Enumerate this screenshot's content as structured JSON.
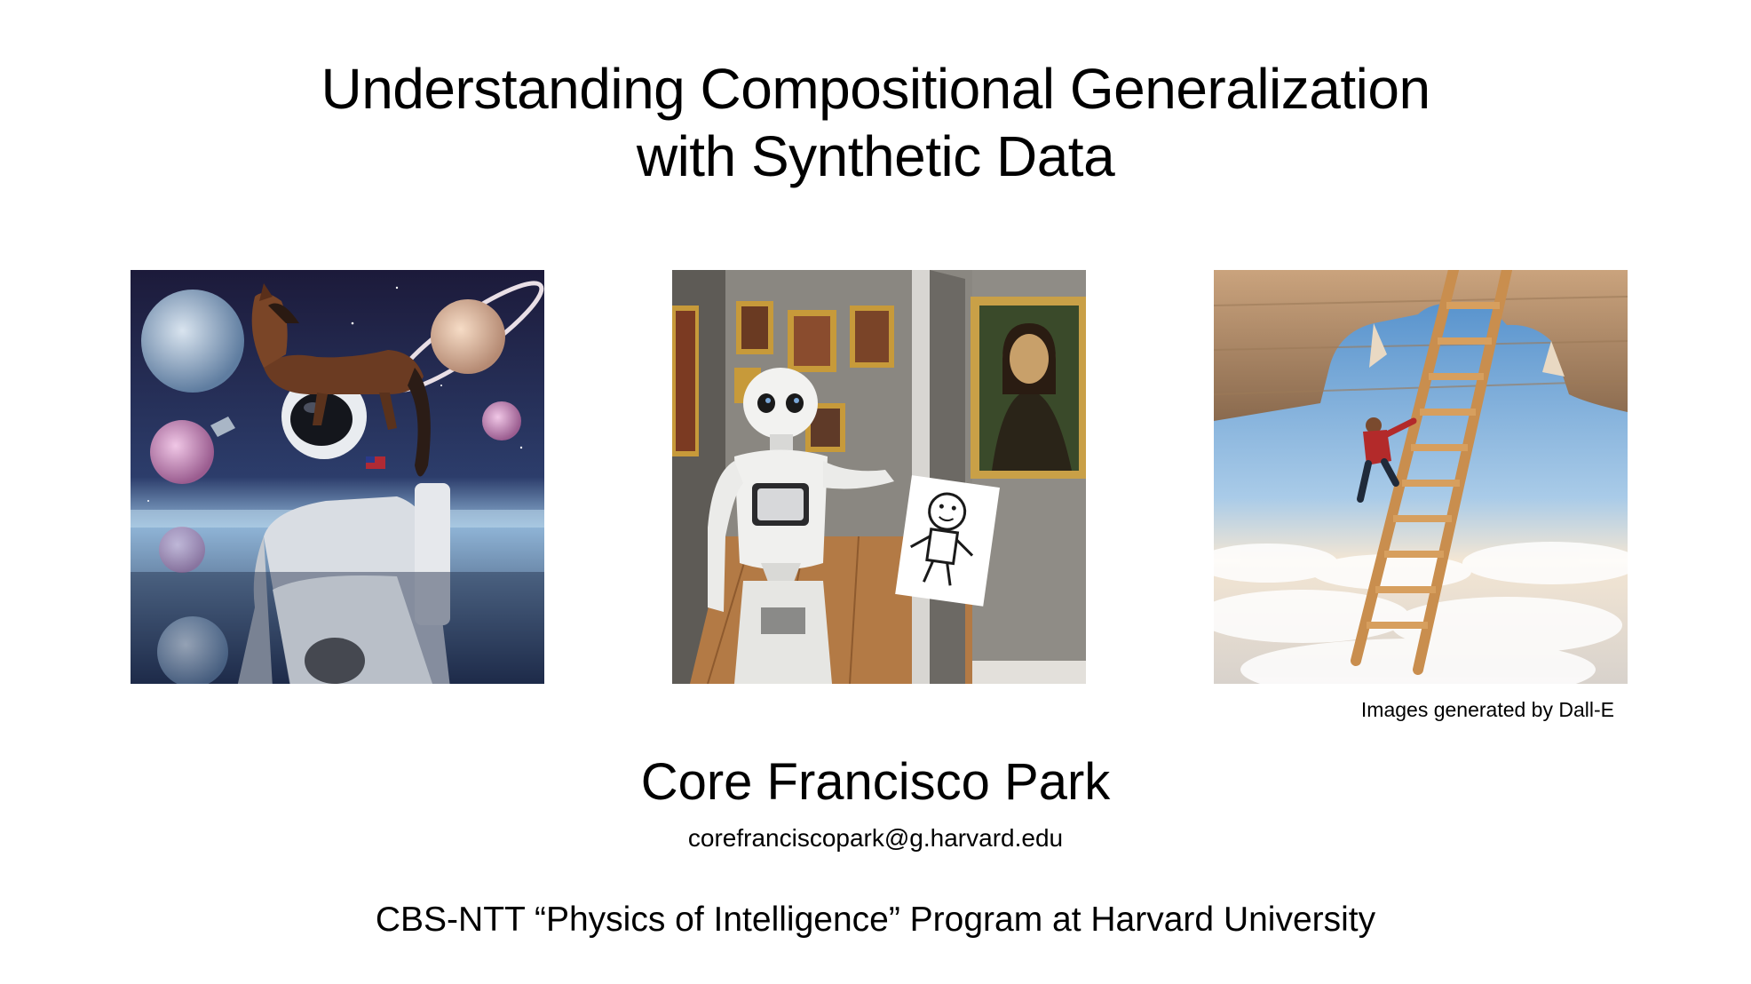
{
  "slide": {
    "title_line1": "Understanding Compositional Generalization",
    "title_line2": "with Synthetic Data",
    "images": [
      {
        "name": "astronaut-horse-image"
      },
      {
        "name": "robot-gallery-image"
      },
      {
        "name": "ladder-sky-image"
      }
    ],
    "image_credit": "Images generated by Dall-E",
    "author": "Core Francisco Park",
    "email": "corefranciscopark@g.harvard.edu",
    "program": "CBS-NTT “Physics of Intelligence” Program at Harvard University"
  }
}
